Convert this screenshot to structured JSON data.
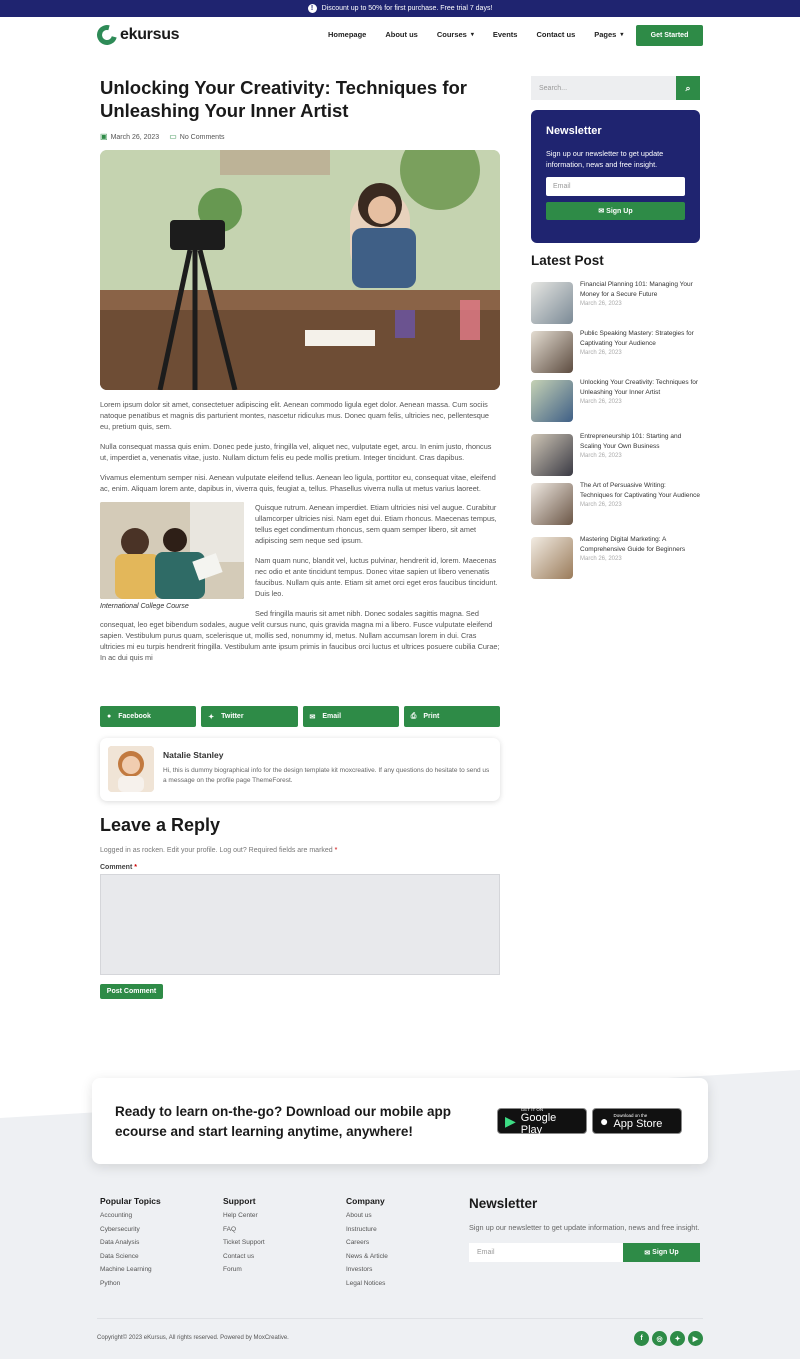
{
  "topbar": {
    "text": "Discount up to 50% for first purchase. Free trial 7 days!"
  },
  "brand": {
    "name": "ekursus"
  },
  "nav": {
    "items": [
      "Homepage",
      "About us",
      "Courses",
      "Events",
      "Contact us",
      "Pages"
    ],
    "cta": "Get Started"
  },
  "article": {
    "title": "Unlocking Your Creativity: Techniques for Unleashing Your Inner Artist",
    "date": "March 26, 2023",
    "comments": "No Comments",
    "paragraphs": [
      "Lorem ipsum dolor sit amet, consectetuer adipiscing elit. Aenean commodo ligula eget dolor. Aenean massa. Cum sociis natoque penatibus et magnis dis parturient montes, nascetur ridiculus mus. Donec quam felis, ultricies nec, pellentesque eu, pretium quis, sem.",
      "Nulla consequat massa quis enim. Donec pede justo, fringilla vel, aliquet nec, vulputate eget, arcu. In enim justo, rhoncus ut, imperdiet a, venenatis vitae, justo. Nullam dictum felis eu pede mollis pretium. Integer tincidunt. Cras dapibus.",
      "Vivamus elementum semper nisi. Aenean vulputate eleifend tellus. Aenean leo ligula, porttitor eu, consequat vitae, eleifend ac, enim. Aliquam lorem ante, dapibus in, viverra quis, feugiat a, tellus. Phasellus viverra nulla ut metus varius laoreet.",
      "Quisque rutrum. Aenean imperdiet. Etiam ultricies nisi vel augue. Curabitur ullamcorper ultricies nisi. Nam eget dui. Etiam rhoncus. Maecenas tempus, tellus eget condimentum rhoncus, sem quam semper libero, sit amet adipiscing sem neque sed ipsum.",
      "Nam quam nunc, blandit vel, luctus pulvinar, hendrerit id, lorem. Maecenas nec odio et ante tincidunt tempus. Donec vitae sapien ut libero venenatis faucibus. Nullam quis ante. Etiam sit amet orci eget eros faucibus tincidunt. Duis leo.",
      "Sed fringilla mauris sit amet nibh. Donec sodales sagittis magna. Sed consequat, leo eget bibendum sodales, augue velit cursus nunc, quis gravida magna mi a libero. Fusce vulputate eleifend sapien. Vestibulum purus quam, scelerisque ut, mollis sed, nonummy id, metus. Nullam accumsan lorem in dui. Cras ultricies mi eu turpis hendrerit fringilla. Vestibulum ante ipsum primis in faucibus orci luctus et ultrices posuere cubilia Curae; In ac dui quis mi"
    ],
    "image_caption": "International College Course"
  },
  "share": {
    "facebook": "Facebook",
    "twitter": "Twitter",
    "email": "Email",
    "print": "Print"
  },
  "author": {
    "name": "Natalie Stanley",
    "bio": "Hi, this is dummy biographical info for the design template kit moxcreative. If any questions do hesitate to send us a message on the profile page ThemeForest."
  },
  "reply": {
    "heading": "Leave a Reply",
    "logged_in": "Logged in as rocken. Edit your profile. Log out? Required fields are marked",
    "required_mark": "*",
    "comment_label": "Comment",
    "submit": "Post Comment"
  },
  "sidebar": {
    "search_placeholder": "Search...",
    "newsletter": {
      "heading": "Newsletter",
      "text": "Sign up our newsletter to get update information, news and free insight.",
      "email_placeholder": "Email",
      "button": "Sign Up"
    },
    "latest_heading": "Latest Post",
    "posts": [
      {
        "title": "Financial Planning 101: Managing Your Money for a Secure Future",
        "date": "March 26, 2023"
      },
      {
        "title": "Public Speaking Mastery: Strategies for Captivating Your Audience",
        "date": "March 26, 2023"
      },
      {
        "title": "Unlocking Your Creativity: Techniques for Unleashing Your Inner Artist",
        "date": "March 26, 2023"
      },
      {
        "title": "Entrepreneurship 101: Starting and Scaling Your Own Business",
        "date": "March 26, 2023"
      },
      {
        "title": "The Art of Persuasive Writing: Techniques for Captivating Your Audience",
        "date": "March 26, 2023"
      },
      {
        "title": "Mastering Digital Marketing: A Comprehensive Guide for Beginners",
        "date": "March 26, 2023"
      }
    ]
  },
  "app_banner": {
    "text": "Ready to learn on-the-go? Download our mobile app ecourse and start learning anytime, anywhere!",
    "google_small": "GET IT ON",
    "google_big": "Google Play",
    "apple_small": "Download on the",
    "apple_big": "App Store"
  },
  "footer": {
    "popular_topics": {
      "heading": "Popular Topics",
      "items": [
        "Accounting",
        "Cybersecurity",
        "Data Analysis",
        "Data Science",
        "Machine Learning",
        "Python"
      ]
    },
    "support": {
      "heading": "Support",
      "items": [
        "Help Center",
        "FAQ",
        "Ticket Support",
        "Contact us",
        "Forum"
      ]
    },
    "company": {
      "heading": "Company",
      "items": [
        "About us",
        "Instructure",
        "Careers",
        "News & Article",
        "Investors",
        "Legal Notices"
      ]
    },
    "newsletter": {
      "heading": "Newsletter",
      "text": "Sign up our newsletter to get update information, news and free insight.",
      "email_placeholder": "Email",
      "button": "Sign Up"
    },
    "copyright": "Copyright© 2023 eKursus, All rights reserved. Powered by MoxCreative."
  },
  "colors": {
    "navy": "#1f2470",
    "green": "#2e8b47"
  }
}
